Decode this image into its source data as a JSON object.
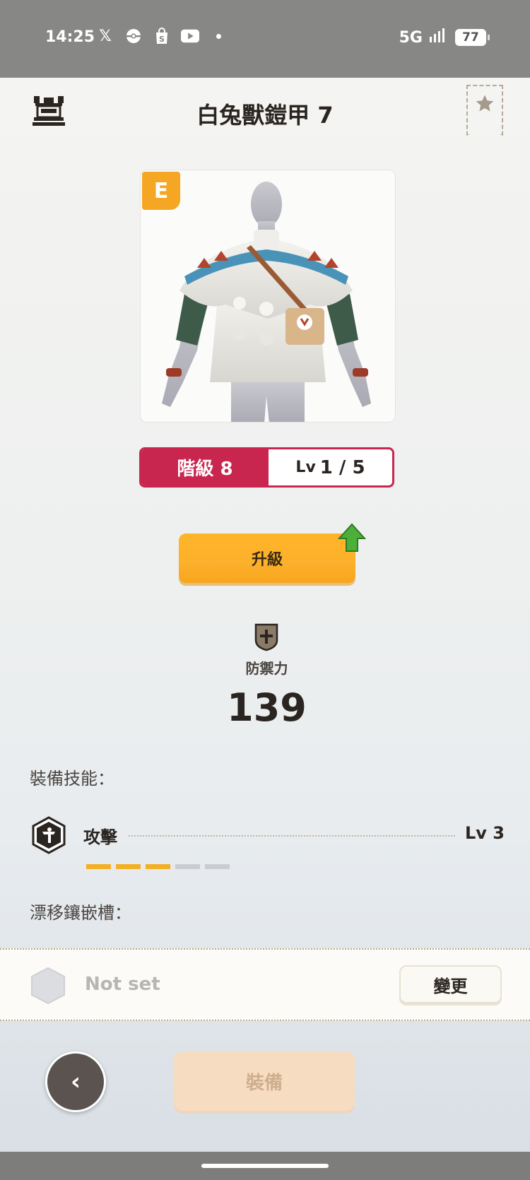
{
  "status_bar": {
    "time": "14:25",
    "network": "5G",
    "battery": "77",
    "icons": [
      "x-icon",
      "pokeball-icon",
      "shopping-bag-icon",
      "youtube-icon",
      "dot-icon",
      "signal-icon",
      "battery-icon"
    ]
  },
  "header": {
    "title": "白兔獸鎧甲 7",
    "left_icon": "castle-icon",
    "right_icon": "star-bookmark-icon"
  },
  "armor": {
    "rank_badge": "E",
    "image": "white-rabbit-armor-icon"
  },
  "grade": {
    "label": "階級 8",
    "level_prefix": "Lv",
    "level_value": "1 / 5",
    "color": "#c8264f"
  },
  "upgrade": {
    "label": "升級",
    "color": "#fcb02b"
  },
  "defense": {
    "label": "防禦力",
    "value": "139"
  },
  "skills": {
    "section_label": "裝備技能：",
    "items": [
      {
        "name": "攻擊",
        "level": "Lv 3",
        "filled": 3,
        "total": 5
      }
    ]
  },
  "slots": {
    "section_label": "漂移鑲嵌槽：",
    "item": {
      "name": "Not set",
      "change_label": "變更"
    }
  },
  "footer": {
    "back_icon": "chevron-left-icon",
    "equip_label": "裝備"
  }
}
